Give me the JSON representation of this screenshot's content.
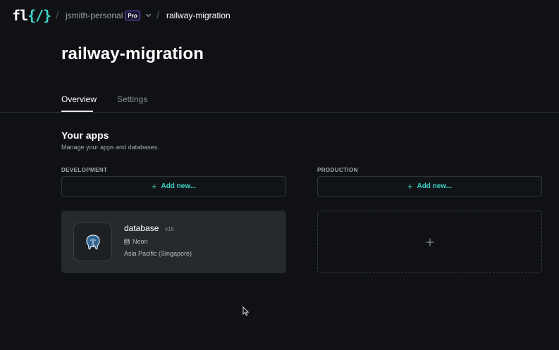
{
  "header": {
    "logo_text_left": "fl",
    "logo_text_accent": "{/}",
    "team": "jsmith-personal",
    "plan_badge": "Pro",
    "project": "railway-migration",
    "separator": "/"
  },
  "page": {
    "title": "railway-migration"
  },
  "tabs": [
    {
      "label": "Overview",
      "active": true
    },
    {
      "label": "Settings",
      "active": false
    }
  ],
  "apps_section": {
    "title": "Your apps",
    "subtitle": "Manage your apps and databases.",
    "columns": {
      "development": {
        "label": "DEVELOPMENT",
        "add_label": "Add new..."
      },
      "production": {
        "label": "PRODUCTION",
        "add_label": "Add new..."
      }
    },
    "development_apps": [
      {
        "name": "database",
        "version": "v15",
        "provider": "Neon",
        "region": "Asia Pacific (Singapore)",
        "icon": "postgres-elephant-icon"
      }
    ]
  },
  "colors": {
    "accent": "#3fd5c9",
    "background": "#0f1114",
    "card": "#26292d",
    "pro_badge_border": "#7b5bd6"
  }
}
